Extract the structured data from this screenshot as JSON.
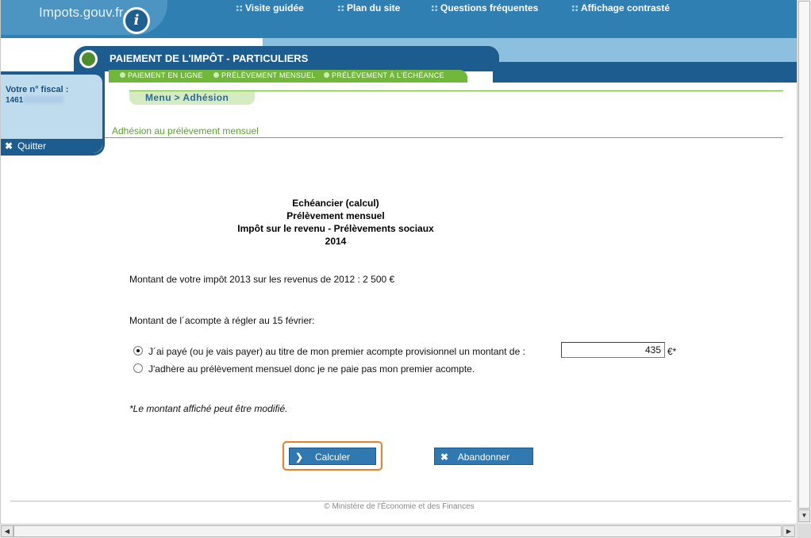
{
  "header": {
    "logo_text": "Impots.gouv.fr",
    "logo_letter": "i",
    "top_links": [
      "Visite guidée",
      "Plan du site",
      "Questions fréquentes",
      "Affichage contrasté"
    ],
    "title": "PAIEMENT DE L'IMPÔT - PARTICULIERS",
    "subnav": [
      "PAIEMENT EN LIGNE",
      "PRÉLÈVEMENT MENSUEL",
      "PRÉLÈVEMENT À L'ÉCHÉANCE"
    ]
  },
  "sidebar": {
    "fiscal_label": "Votre n° fiscal :",
    "fiscal_number_visible": "1461",
    "quit_label": "Quitter"
  },
  "breadcrumb": {
    "text": "Menu  >  Adhésion"
  },
  "section_title": "Adhésion au prélèvement mensuel",
  "heading": {
    "line1": "Echéancier (calcul)",
    "line2": "Prélèvement mensuel",
    "line3": "Impôt sur le revenu - Prélèvements sociaux",
    "line4": "2014"
  },
  "form": {
    "tax_amount_text": "Montant de votre impôt 2013 sur les revenus de 2012  : 2 500 €",
    "acompte_label": "Montant de l´acompte à régler au 15 février:",
    "option1_label": "J´ai payé (ou je vais payer) au titre de mon premier acompte provisionnel un montant de :",
    "option2_label": "J'adhère au prélèvement mensuel donc je ne paie pas mon premier acompte.",
    "amount_value": "435",
    "currency_suffix": "€*",
    "selected_option": 1,
    "note": "*Le montant affiché peut être modifié."
  },
  "buttons": {
    "calculate": "Calculer",
    "abandon": "Abandonner"
  },
  "footer": {
    "text": "© Ministère de l'Économie et des Finances"
  },
  "colors": {
    "brand_blue": "#1d5c8e",
    "green": "#71b73b",
    "highlight_orange": "#ef7d24"
  }
}
